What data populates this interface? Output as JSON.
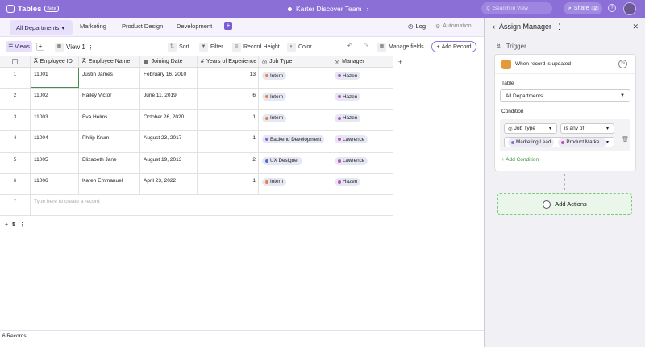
{
  "app": {
    "title": "Tables",
    "badge": "Beta",
    "team": "Karter Discover Team",
    "search_placeholder": "Search in View",
    "share_label": "Share",
    "share_count": "2"
  },
  "tabs": {
    "active": "All Departments",
    "items": [
      "Marketing",
      "Product Design",
      "Development"
    ]
  },
  "header_actions": {
    "log": "Log",
    "automation": "Automation"
  },
  "toolbar": {
    "views": "Views",
    "view_name": "View 1",
    "sort": "Sort",
    "filter": "Filter",
    "record_height": "Record Height",
    "color": "Color",
    "manage_fields": "Manage fields",
    "add_record": "Add Record"
  },
  "columns": [
    "Employee ID",
    "Employee Name",
    "Joining Date",
    "Years of Experience",
    "Job Type",
    "Manager"
  ],
  "rows": [
    {
      "no": "1",
      "id": "11001",
      "name": "Justin James",
      "date": "February 16, 2010",
      "years": "13",
      "job": "Intern",
      "manager": "Hazen"
    },
    {
      "no": "2",
      "id": "11002",
      "name": "Railey Victor",
      "date": "June 11, 2019",
      "years": "6",
      "job": "Intern",
      "manager": "Hazen"
    },
    {
      "no": "3",
      "id": "11003",
      "name": "Eva Helms",
      "date": "October 26, 2020",
      "years": "1",
      "job": "Intern",
      "manager": "Hazen"
    },
    {
      "no": "4",
      "id": "11004",
      "name": "Philip Krum",
      "date": "August 23, 2017",
      "years": "1",
      "job": "Backend Development",
      "manager": "Lawrence"
    },
    {
      "no": "5",
      "id": "11005",
      "name": "Elizabeth Jane",
      "date": "August 19, 2013",
      "years": "2",
      "job": "UX Designer",
      "manager": "Lawrence"
    },
    {
      "no": "6",
      "id": "11006",
      "name": "Karen Emmanuel",
      "date": "April 23, 2022",
      "years": "1",
      "job": "Intern",
      "manager": "Hazen"
    }
  ],
  "new_row": {
    "no": "7",
    "placeholder": "Type here to create a record"
  },
  "footer": {
    "group_count": "5",
    "records": "6 Records"
  },
  "colors": {
    "intern": "#e8803a",
    "backend": "#9c5ad8",
    "ux": "#4a6fd8",
    "manager": "#c24ec0"
  },
  "panel": {
    "title": "Assign Manager",
    "trigger": "Trigger",
    "trigger_text": "When record is updated",
    "table_label": "Table",
    "table_value": "All Departments",
    "condition_label": "Condition",
    "field": "Job Type",
    "operator": "is any of",
    "value1": "Marketing Lead",
    "value2": "Product Marke...",
    "add_condition": "+ Add Condition",
    "add_actions": "Add Actions"
  }
}
